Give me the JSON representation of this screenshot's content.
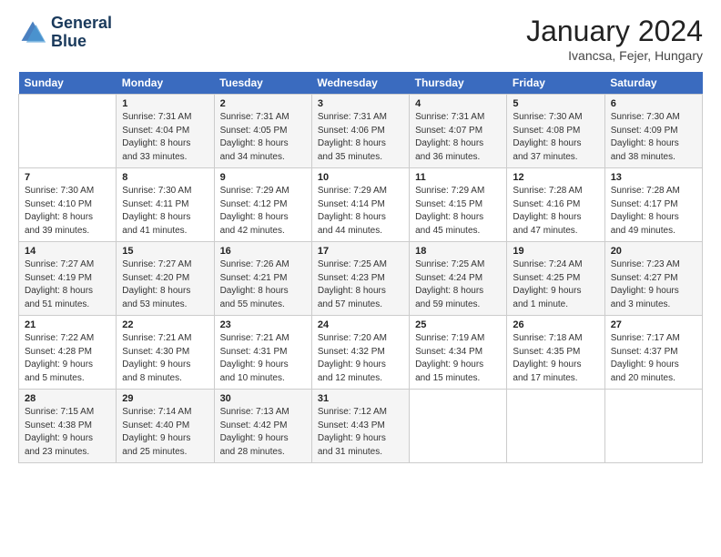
{
  "header": {
    "logo_line1": "General",
    "logo_line2": "Blue",
    "main_title": "January 2024",
    "subtitle": "Ivancsa, Fejer, Hungary"
  },
  "days_of_week": [
    "Sunday",
    "Monday",
    "Tuesday",
    "Wednesday",
    "Thursday",
    "Friday",
    "Saturday"
  ],
  "weeks": [
    [
      {
        "day": "",
        "info": ""
      },
      {
        "day": "1",
        "info": "Sunrise: 7:31 AM\nSunset: 4:04 PM\nDaylight: 8 hours\nand 33 minutes."
      },
      {
        "day": "2",
        "info": "Sunrise: 7:31 AM\nSunset: 4:05 PM\nDaylight: 8 hours\nand 34 minutes."
      },
      {
        "day": "3",
        "info": "Sunrise: 7:31 AM\nSunset: 4:06 PM\nDaylight: 8 hours\nand 35 minutes."
      },
      {
        "day": "4",
        "info": "Sunrise: 7:31 AM\nSunset: 4:07 PM\nDaylight: 8 hours\nand 36 minutes."
      },
      {
        "day": "5",
        "info": "Sunrise: 7:30 AM\nSunset: 4:08 PM\nDaylight: 8 hours\nand 37 minutes."
      },
      {
        "day": "6",
        "info": "Sunrise: 7:30 AM\nSunset: 4:09 PM\nDaylight: 8 hours\nand 38 minutes."
      }
    ],
    [
      {
        "day": "7",
        "info": "Sunrise: 7:30 AM\nSunset: 4:10 PM\nDaylight: 8 hours\nand 39 minutes."
      },
      {
        "day": "8",
        "info": "Sunrise: 7:30 AM\nSunset: 4:11 PM\nDaylight: 8 hours\nand 41 minutes."
      },
      {
        "day": "9",
        "info": "Sunrise: 7:29 AM\nSunset: 4:12 PM\nDaylight: 8 hours\nand 42 minutes."
      },
      {
        "day": "10",
        "info": "Sunrise: 7:29 AM\nSunset: 4:14 PM\nDaylight: 8 hours\nand 44 minutes."
      },
      {
        "day": "11",
        "info": "Sunrise: 7:29 AM\nSunset: 4:15 PM\nDaylight: 8 hours\nand 45 minutes."
      },
      {
        "day": "12",
        "info": "Sunrise: 7:28 AM\nSunset: 4:16 PM\nDaylight: 8 hours\nand 47 minutes."
      },
      {
        "day": "13",
        "info": "Sunrise: 7:28 AM\nSunset: 4:17 PM\nDaylight: 8 hours\nand 49 minutes."
      }
    ],
    [
      {
        "day": "14",
        "info": "Sunrise: 7:27 AM\nSunset: 4:19 PM\nDaylight: 8 hours\nand 51 minutes."
      },
      {
        "day": "15",
        "info": "Sunrise: 7:27 AM\nSunset: 4:20 PM\nDaylight: 8 hours\nand 53 minutes."
      },
      {
        "day": "16",
        "info": "Sunrise: 7:26 AM\nSunset: 4:21 PM\nDaylight: 8 hours\nand 55 minutes."
      },
      {
        "day": "17",
        "info": "Sunrise: 7:25 AM\nSunset: 4:23 PM\nDaylight: 8 hours\nand 57 minutes."
      },
      {
        "day": "18",
        "info": "Sunrise: 7:25 AM\nSunset: 4:24 PM\nDaylight: 8 hours\nand 59 minutes."
      },
      {
        "day": "19",
        "info": "Sunrise: 7:24 AM\nSunset: 4:25 PM\nDaylight: 9 hours\nand 1 minute."
      },
      {
        "day": "20",
        "info": "Sunrise: 7:23 AM\nSunset: 4:27 PM\nDaylight: 9 hours\nand 3 minutes."
      }
    ],
    [
      {
        "day": "21",
        "info": "Sunrise: 7:22 AM\nSunset: 4:28 PM\nDaylight: 9 hours\nand 5 minutes."
      },
      {
        "day": "22",
        "info": "Sunrise: 7:21 AM\nSunset: 4:30 PM\nDaylight: 9 hours\nand 8 minutes."
      },
      {
        "day": "23",
        "info": "Sunrise: 7:21 AM\nSunset: 4:31 PM\nDaylight: 9 hours\nand 10 minutes."
      },
      {
        "day": "24",
        "info": "Sunrise: 7:20 AM\nSunset: 4:32 PM\nDaylight: 9 hours\nand 12 minutes."
      },
      {
        "day": "25",
        "info": "Sunrise: 7:19 AM\nSunset: 4:34 PM\nDaylight: 9 hours\nand 15 minutes."
      },
      {
        "day": "26",
        "info": "Sunrise: 7:18 AM\nSunset: 4:35 PM\nDaylight: 9 hours\nand 17 minutes."
      },
      {
        "day": "27",
        "info": "Sunrise: 7:17 AM\nSunset: 4:37 PM\nDaylight: 9 hours\nand 20 minutes."
      }
    ],
    [
      {
        "day": "28",
        "info": "Sunrise: 7:15 AM\nSunset: 4:38 PM\nDaylight: 9 hours\nand 23 minutes."
      },
      {
        "day": "29",
        "info": "Sunrise: 7:14 AM\nSunset: 4:40 PM\nDaylight: 9 hours\nand 25 minutes."
      },
      {
        "day": "30",
        "info": "Sunrise: 7:13 AM\nSunset: 4:42 PM\nDaylight: 9 hours\nand 28 minutes."
      },
      {
        "day": "31",
        "info": "Sunrise: 7:12 AM\nSunset: 4:43 PM\nDaylight: 9 hours\nand 31 minutes."
      },
      {
        "day": "",
        "info": ""
      },
      {
        "day": "",
        "info": ""
      },
      {
        "day": "",
        "info": ""
      }
    ]
  ]
}
